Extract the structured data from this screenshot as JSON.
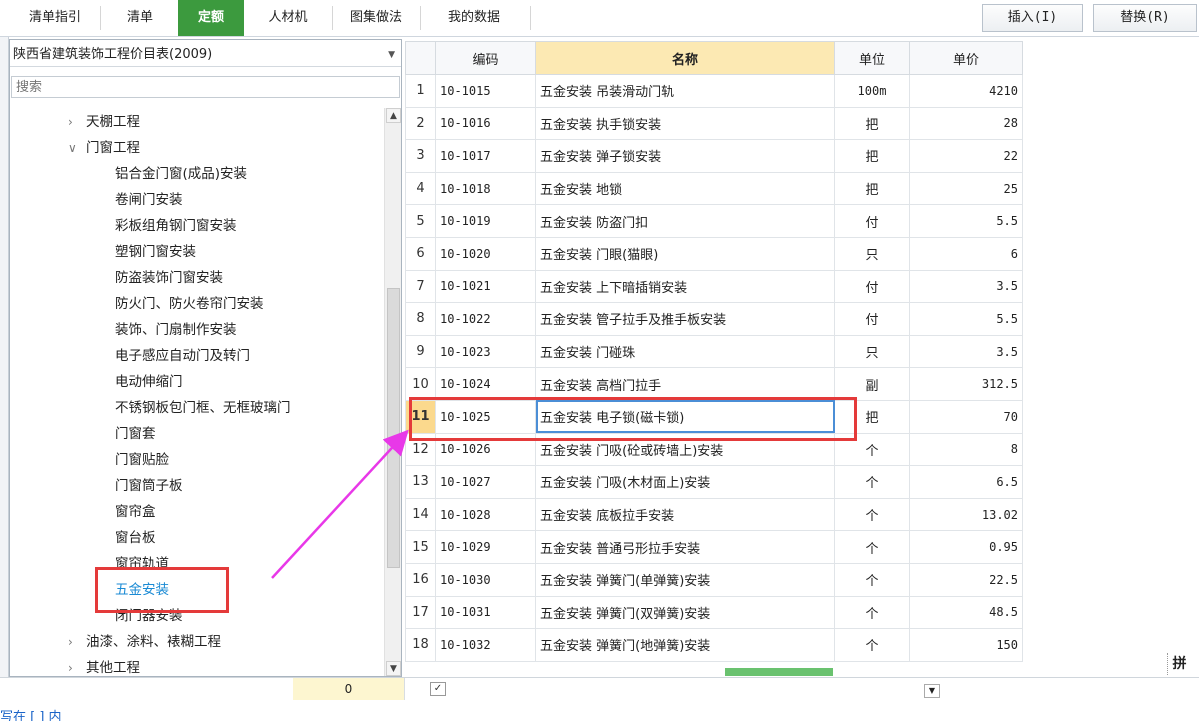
{
  "tabs": [
    {
      "label": "清单指引",
      "active": false
    },
    {
      "label": "清单",
      "active": false
    },
    {
      "label": "定额",
      "active": true
    },
    {
      "label": "人材机",
      "active": false
    },
    {
      "label": "图集做法",
      "active": false
    },
    {
      "label": "我的数据",
      "active": false
    }
  ],
  "toolbar": {
    "insert_label": "插入(I)",
    "replace_label": "替换(R)"
  },
  "library": {
    "selected": "陕西省建筑装饰工程价目表(2009)"
  },
  "search": {
    "placeholder": "搜索"
  },
  "tree": [
    {
      "label": "天棚工程",
      "level": 1,
      "expanded": false
    },
    {
      "label": "门窗工程",
      "level": 1,
      "expanded": true
    },
    {
      "label": "铝合金门窗(成品)安装",
      "level": 2
    },
    {
      "label": "卷闸门安装",
      "level": 2
    },
    {
      "label": "彩板组角钢门窗安装",
      "level": 2
    },
    {
      "label": "塑钢门窗安装",
      "level": 2
    },
    {
      "label": "防盗装饰门窗安装",
      "level": 2
    },
    {
      "label": "防火门、防火卷帘门安装",
      "level": 2
    },
    {
      "label": "装饰、门扇制作安装",
      "level": 2
    },
    {
      "label": "电子感应自动门及转门",
      "level": 2
    },
    {
      "label": "电动伸缩门",
      "level": 2
    },
    {
      "label": "不锈钢板包门框、无框玻璃门",
      "level": 2
    },
    {
      "label": "门窗套",
      "level": 2
    },
    {
      "label": "门窗贴脸",
      "level": 2
    },
    {
      "label": "门窗筒子板",
      "level": 2
    },
    {
      "label": "窗帘盒",
      "level": 2
    },
    {
      "label": "窗台板",
      "level": 2
    },
    {
      "label": "窗帘轨道",
      "level": 2
    },
    {
      "label": "五金安装",
      "level": 2,
      "selected": true
    },
    {
      "label": "闭门器安装",
      "level": 2
    },
    {
      "label": "油漆、涂料、裱糊工程",
      "level": 1,
      "expanded": false
    },
    {
      "label": "其他工程",
      "level": 1,
      "expanded": false
    }
  ],
  "table": {
    "headers": [
      "编码",
      "名称",
      "单位",
      "单价"
    ],
    "rows": [
      {
        "n": "1",
        "code": "10-1015",
        "name": "五金安装 吊装滑动门轨",
        "unit": "100m",
        "price": "4210"
      },
      {
        "n": "2",
        "code": "10-1016",
        "name": "五金安装 执手锁安装",
        "unit": "把",
        "price": "28"
      },
      {
        "n": "3",
        "code": "10-1017",
        "name": "五金安装 弹子锁安装",
        "unit": "把",
        "price": "22"
      },
      {
        "n": "4",
        "code": "10-1018",
        "name": "五金安装 地锁",
        "unit": "把",
        "price": "25"
      },
      {
        "n": "5",
        "code": "10-1019",
        "name": "五金安装 防盗门扣",
        "unit": "付",
        "price": "5.5"
      },
      {
        "n": "6",
        "code": "10-1020",
        "name": "五金安装 门眼(猫眼)",
        "unit": "只",
        "price": "6"
      },
      {
        "n": "7",
        "code": "10-1021",
        "name": "五金安装 上下暗插销安装",
        "unit": "付",
        "price": "3.5"
      },
      {
        "n": "8",
        "code": "10-1022",
        "name": "五金安装 管子拉手及推手板安装",
        "unit": "付",
        "price": "5.5"
      },
      {
        "n": "9",
        "code": "10-1023",
        "name": "五金安装 门碰珠",
        "unit": "只",
        "price": "3.5"
      },
      {
        "n": "10",
        "code": "10-1024",
        "name": "五金安装 高档门拉手",
        "unit": "副",
        "price": "312.5"
      },
      {
        "n": "11",
        "code": "10-1025",
        "name": "五金安装 电子锁(磁卡锁)",
        "unit": "把",
        "price": "70"
      },
      {
        "n": "12",
        "code": "10-1026",
        "name": "五金安装 门吸(砼或砖墙上)安装",
        "unit": "个",
        "price": "8"
      },
      {
        "n": "13",
        "code": "10-1027",
        "name": "五金安装 门吸(木材面上)安装",
        "unit": "个",
        "price": "6.5"
      },
      {
        "n": "14",
        "code": "10-1028",
        "name": "五金安装 底板拉手安装",
        "unit": "个",
        "price": "13.02"
      },
      {
        "n": "15",
        "code": "10-1029",
        "name": "五金安装 普通弓形拉手安装",
        "unit": "个",
        "price": "0.95"
      },
      {
        "n": "16",
        "code": "10-1030",
        "name": "五金安装 弹簧门(单弹簧)安装",
        "unit": "个",
        "price": "22.5"
      },
      {
        "n": "17",
        "code": "10-1031",
        "name": "五金安装 弹簧门(双弹簧)安装",
        "unit": "个",
        "price": "48.5"
      },
      {
        "n": "18",
        "code": "10-1032",
        "name": "五金安装 弹簧门(地弹簧)安装",
        "unit": "个",
        "price": "150"
      }
    ],
    "current_row": "11"
  },
  "side_label": "拼",
  "bottom": {
    "zero_value": "0",
    "link_text": "写在 [ ] 内"
  },
  "colors": {
    "active_tab": "#3c9a3e",
    "annotation": "#e43a3a",
    "arrow": "#e838e8",
    "highlight_header": "#fce9b3"
  }
}
